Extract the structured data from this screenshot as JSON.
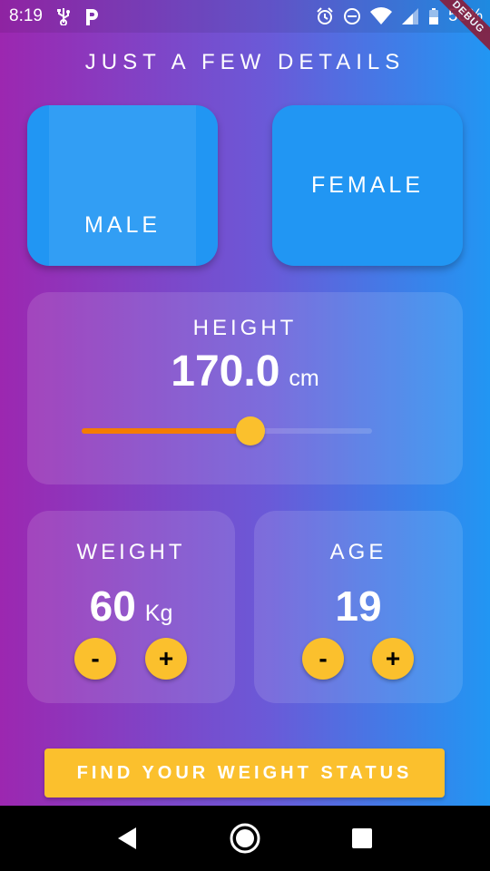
{
  "status_bar": {
    "time": "8:19",
    "battery_percent": "50%",
    "icons": [
      "usb-icon",
      "p-app-icon",
      "alarm-icon",
      "dnd-icon",
      "wifi-icon",
      "signal-icon",
      "battery-icon"
    ]
  },
  "debug_ribbon": "DEBUG",
  "page": {
    "title": "JUST A FEW DETAILS"
  },
  "gender": {
    "male_label": "MALE",
    "female_label": "FEMALE"
  },
  "height": {
    "label": "HEIGHT",
    "value": "170.0",
    "unit": "cm",
    "slider_fraction": 0.58
  },
  "weight": {
    "label": "WEIGHT",
    "value": "60",
    "unit": "Kg",
    "minus_label": "-",
    "plus_label": "+"
  },
  "age": {
    "label": "AGE",
    "value": "19",
    "minus_label": "-",
    "plus_label": "+"
  },
  "cta": {
    "label": "FIND YOUR WEIGHT STATUS"
  },
  "colors": {
    "gradient_start": "#9c27b0",
    "gradient_end": "#2196f3",
    "card_blue": "#2196f3",
    "accent_yellow": "#fbc02d",
    "slider_orange": "#f57c00"
  },
  "nav_bar": {
    "icons": [
      "back-icon",
      "home-icon",
      "recents-icon"
    ]
  }
}
